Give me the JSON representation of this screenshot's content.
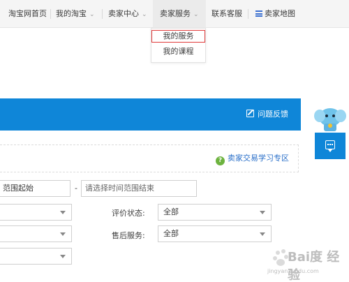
{
  "topnav": {
    "home": "淘宝网首页",
    "my_taobao": "我的淘宝",
    "seller_center": "卖家中心",
    "seller_service": "卖家服务",
    "support": "联系客服",
    "seller_map": "卖家地图"
  },
  "dropdown": {
    "items": [
      "我的服务",
      "我的课程"
    ]
  },
  "banner": {
    "feedback": "问题反馈"
  },
  "learning": {
    "link": "卖家交易学习专区"
  },
  "form": {
    "time_range_start": "范围起始",
    "range_dash": "-",
    "time_range_end_placeholder": "请选择时间范围结束",
    "rating_label": "评价状态:",
    "rating_value": "全部",
    "aftersale_label": "售后服务:",
    "aftersale_value": "全部"
  },
  "watermark": {
    "brand": "Bai度 经验",
    "url": "jingyan.baidu.com"
  },
  "colors": {
    "accent": "#0f86d8",
    "highlight": "#e03a3a",
    "link": "#2a6fc9"
  }
}
